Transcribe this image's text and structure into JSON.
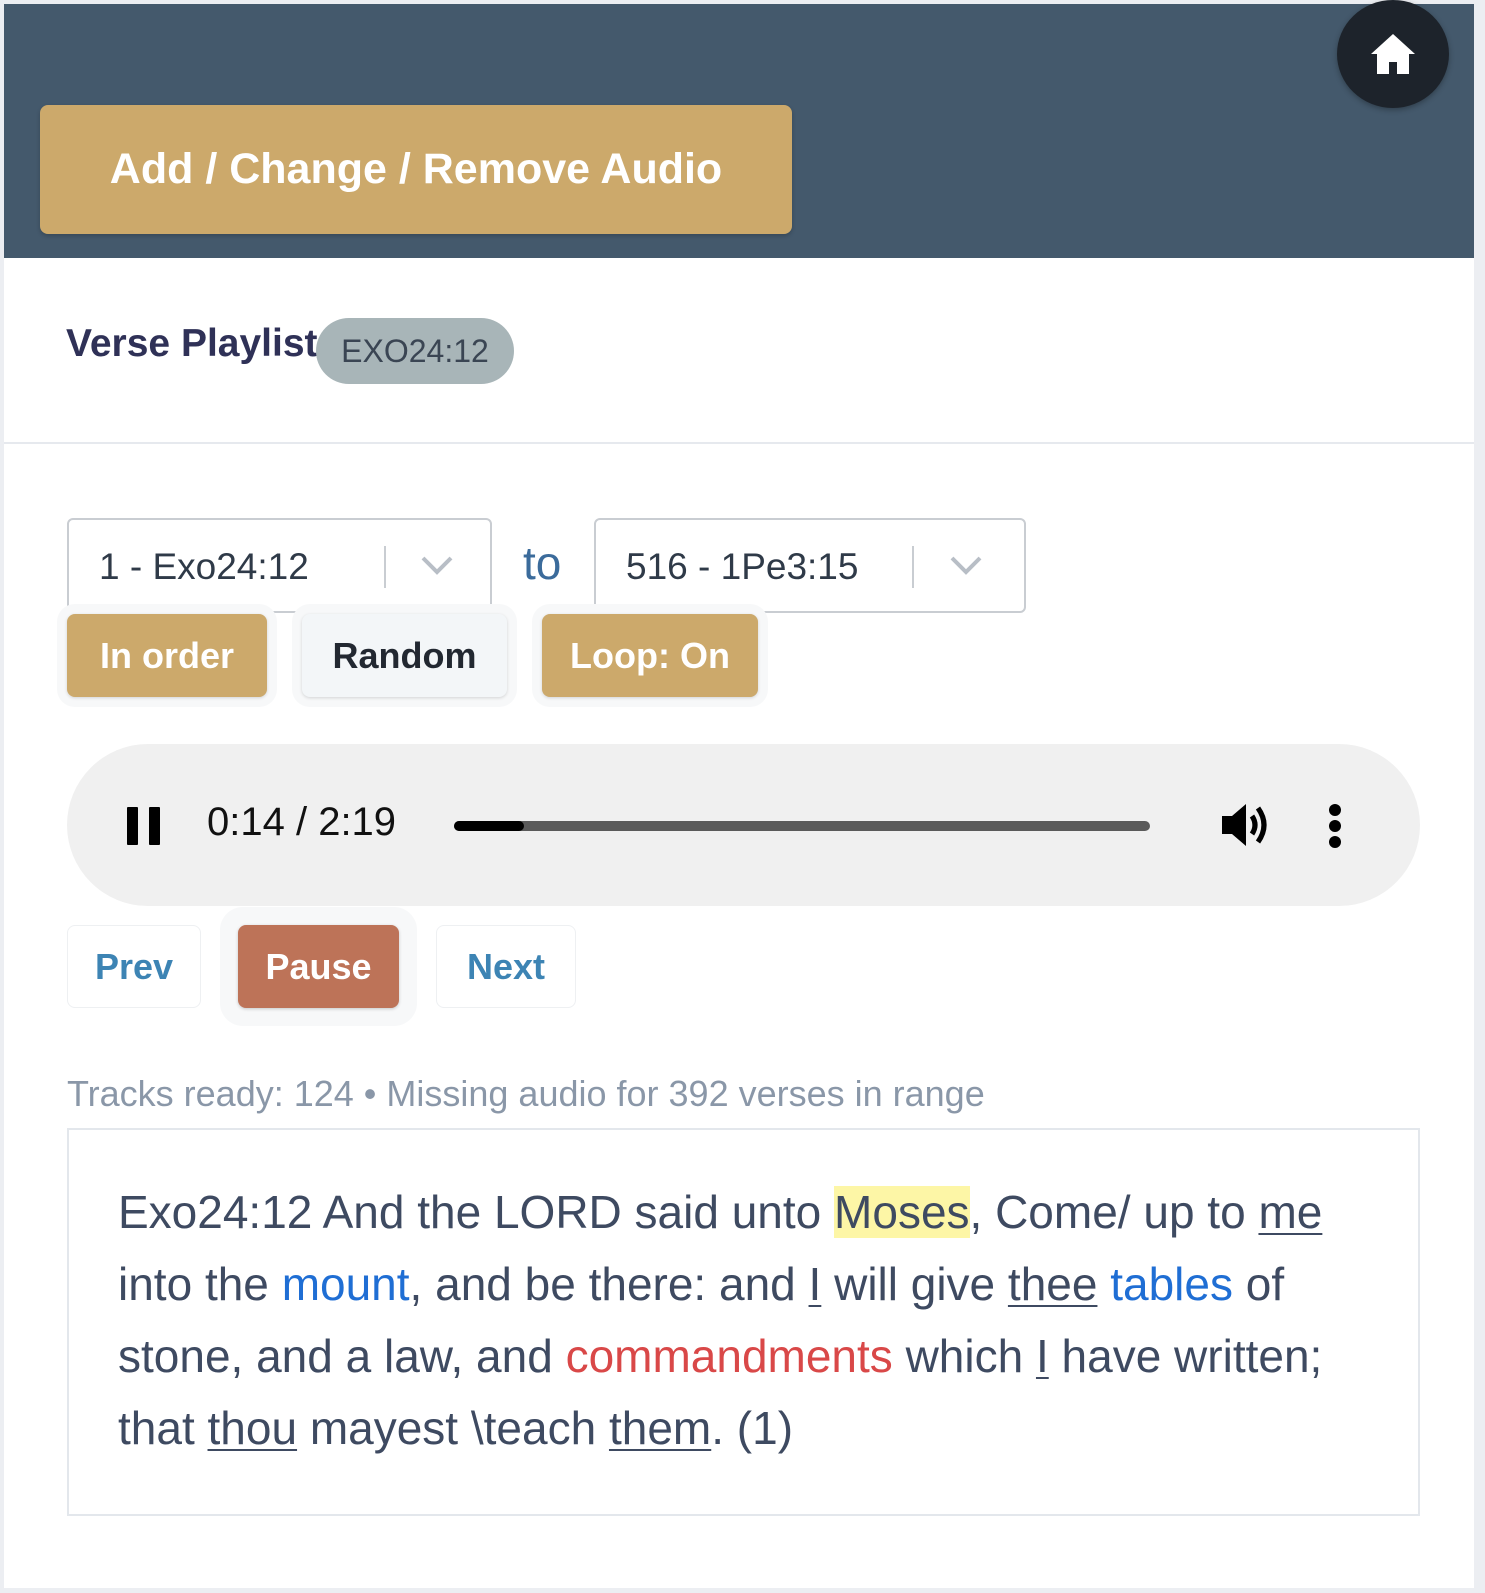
{
  "header": {
    "home_icon": "home-icon",
    "add_audio_label": "Add / Change / Remove Audio"
  },
  "playlist": {
    "title": "Verse Playlist",
    "badge": "EXO24:12"
  },
  "range": {
    "from": "1 - Exo24:12",
    "to_label": "to",
    "to": "516 - 1Pe3:15"
  },
  "modes": {
    "in_order": "In order",
    "random": "Random",
    "loop": "Loop: On"
  },
  "player": {
    "time": "0:14 / 2:19",
    "progress": 0.1,
    "icons": [
      "pause-icon",
      "volume-icon",
      "more-vertical-icon"
    ]
  },
  "controls": {
    "prev": "Prev",
    "pause": "Pause",
    "next": "Next"
  },
  "status": "Tracks ready: 124 • Missing audio for 392 verses in range",
  "verse": {
    "segments": [
      {
        "t": "Exo24:12 And the LORD said unto ",
        "s": ""
      },
      {
        "t": "Moses",
        "s": "hl"
      },
      {
        "t": ", Come/ up to ",
        "s": ""
      },
      {
        "t": "me",
        "s": "u"
      },
      {
        "t": " into the ",
        "s": ""
      },
      {
        "t": "mount",
        "s": "blue"
      },
      {
        "t": ", and be there: and ",
        "s": ""
      },
      {
        "t": "I",
        "s": "u"
      },
      {
        "t": " will give ",
        "s": ""
      },
      {
        "t": "thee",
        "s": "u"
      },
      {
        "t": " ",
        "s": ""
      },
      {
        "t": "tables",
        "s": "blue"
      },
      {
        "t": " of stone, and a law, and ",
        "s": ""
      },
      {
        "t": "commandments",
        "s": "red"
      },
      {
        "t": " which ",
        "s": ""
      },
      {
        "t": "I",
        "s": "u"
      },
      {
        "t": " have written; that ",
        "s": ""
      },
      {
        "t": "thou",
        "s": "u"
      },
      {
        "t": " mayest \\teach ",
        "s": ""
      },
      {
        "t": "them",
        "s": "u"
      },
      {
        "t": ". (1)",
        "s": ""
      }
    ]
  },
  "colors": {
    "header_bg": "#44596c",
    "accent_gold": "#cca96b",
    "pause_btn": "#bd7358",
    "link_blue": "#3d84b4",
    "highlight": "#fdf6a6"
  }
}
